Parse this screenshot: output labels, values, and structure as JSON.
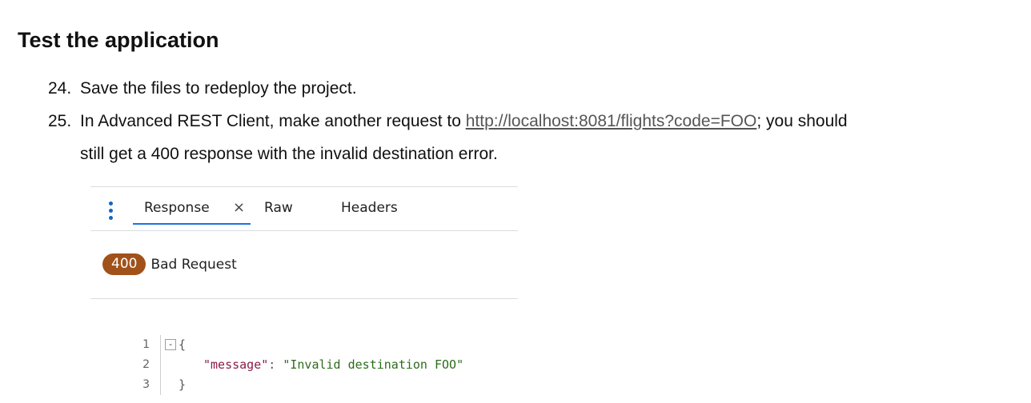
{
  "heading": "Test the application",
  "steps": [
    {
      "num": "24.",
      "text": "Save the files to redeploy the project."
    },
    {
      "num": "25.",
      "text_before": "In Advanced REST Client, make another request to ",
      "link": "http://localhost:8081/flights?code=FOO",
      "text_after": "; you should",
      "text_line2": "still get a 400 response with the invalid destination error."
    }
  ],
  "response_panel": {
    "menu_icon": "kebab-vertical-icon",
    "tabs": {
      "response": "Response",
      "close": "×",
      "raw": "Raw",
      "headers": "Headers"
    },
    "status_code": "400",
    "status_text": "Bad Request",
    "colors": {
      "status_badge": "#a0521a",
      "tab_underline": "#1a73e8",
      "json_key": "#8b1a4a",
      "json_value": "#2e6b1c"
    },
    "code": {
      "line_numbers": [
        "1",
        "2",
        "3"
      ],
      "fold_marker": "-",
      "open_brace": "{",
      "close_brace": "}",
      "key": "\"message\"",
      "colon": ": ",
      "value": "\"Invalid destination FOO\""
    }
  }
}
